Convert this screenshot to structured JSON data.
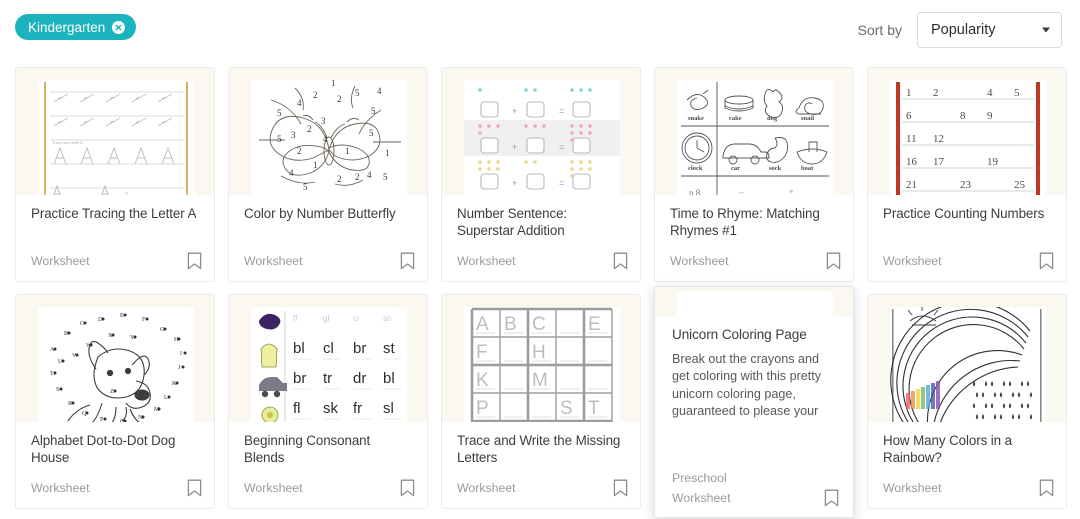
{
  "filters": {
    "chips": [
      {
        "label": "Kindergarten",
        "remove_icon": "close-circle-icon"
      }
    ]
  },
  "sort": {
    "label": "Sort by",
    "value": "Popularity",
    "caret_icon": "chevron-down-icon",
    "options": [
      "Popularity"
    ]
  },
  "accent_color": "#1bb3bd",
  "thumb_bg_color": "#fbf8f1",
  "cards": [
    {
      "title": "Practice Tracing the Letter A",
      "resource_type": "Worksheet",
      "bookmark_icon": "bookmark-icon",
      "thumb": "tracing-letter-a",
      "hovered": false
    },
    {
      "title": "Color by Number Butterfly",
      "resource_type": "Worksheet",
      "bookmark_icon": "bookmark-icon",
      "thumb": "color-by-number-butterfly",
      "hovered": false
    },
    {
      "title": "Number Sentence: Superstar Addition",
      "resource_type": "Worksheet",
      "bookmark_icon": "bookmark-icon",
      "thumb": "superstar-addition",
      "hovered": false
    },
    {
      "title": "Time to Rhyme: Matching Rhymes #1",
      "resource_type": "Worksheet",
      "bookmark_icon": "bookmark-icon",
      "thumb": "matching-rhymes",
      "thumb_words": [
        "snake",
        "cake",
        "dog",
        "snail",
        "clock",
        "car",
        "sock",
        "boat"
      ],
      "hovered": false
    },
    {
      "title": "Practice Counting Numbers",
      "resource_type": "Worksheet",
      "bookmark_icon": "bookmark-icon",
      "thumb": "counting-numbers",
      "thumb_numbers": [
        [
          "1",
          "2",
          "",
          "4",
          "5"
        ],
        [
          "6",
          "",
          "8",
          "9",
          ""
        ],
        [
          "11",
          "12",
          "",
          "",
          ""
        ],
        [
          "16",
          "17",
          "",
          "19",
          ""
        ],
        [
          "21",
          "",
          "23",
          "",
          "25"
        ]
      ],
      "hovered": false
    },
    {
      "title": "Alphabet Dot-to-Dot Dog House",
      "resource_type": "Worksheet",
      "bookmark_icon": "bookmark-icon",
      "thumb": "dot-to-dot-dog",
      "hovered": false
    },
    {
      "title": "Beginning Consonant Blends",
      "resource_type": "Worksheet",
      "bookmark_icon": "bookmark-icon",
      "thumb": "consonant-blends",
      "thumb_blends": [
        [
          "bl",
          "cl",
          "br",
          "st"
        ],
        [
          "br",
          "tr",
          "dr",
          "bl"
        ],
        [
          "fl",
          "sk",
          "fr",
          "sl"
        ]
      ],
      "hovered": false
    },
    {
      "title": "Trace and Write the Missing Letters",
      "resource_type": "Worksheet",
      "bookmark_icon": "bookmark-icon",
      "thumb": "missing-letters",
      "thumb_letters": [
        [
          "A",
          "B",
          "C",
          "",
          "E"
        ],
        [
          "F",
          "",
          "H",
          "",
          ""
        ],
        [
          "K",
          "",
          "M",
          "",
          ""
        ],
        [
          "P",
          "",
          "",
          "S",
          "T"
        ]
      ],
      "hovered": false
    },
    {
      "title": "Unicorn Coloring Page",
      "description": "Break out the crayons and get coloring with this pretty unicorn coloring page, guaranteed to please your",
      "grade": "Preschool",
      "resource_type": "Worksheet",
      "bookmark_icon": "bookmark-icon",
      "thumb": "unicorn-coloring",
      "hovered": true
    },
    {
      "title": "How Many Colors in a Rainbow?",
      "resource_type": "Worksheet",
      "bookmark_icon": "bookmark-icon",
      "thumb": "rainbow-colors",
      "hovered": false
    }
  ]
}
